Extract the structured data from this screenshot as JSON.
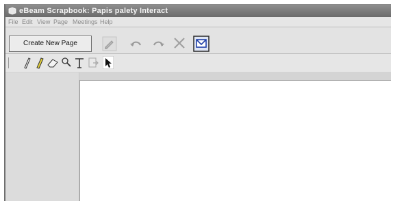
{
  "window": {
    "title": "eBeam Scrapbook: Papis palety Interact"
  },
  "menubar": {
    "items": [
      {
        "label": "File"
      },
      {
        "label": "Edit"
      },
      {
        "label": "View"
      },
      {
        "label": "Page"
      },
      {
        "label": "Meetings"
      },
      {
        "label": "Help"
      }
    ]
  },
  "toolbar": {
    "new_page_label": "Create New Page",
    "icons": [
      "pen-icon",
      "undo-icon",
      "redo-icon",
      "delete-icon",
      "email-icon"
    ]
  },
  "tools": {
    "icons": [
      "pencil-icon",
      "highlighter-icon",
      "eraser-icon",
      "zoom-icon",
      "text-icon",
      "insert-icon",
      "pointer-icon"
    ]
  },
  "colors": {
    "titlebar": "#7a7a7a",
    "canvas": "#ffffff",
    "panel": "#dcdcdc",
    "highlighter": "#e6d23a",
    "email_accent": "#1f3fa8"
  }
}
